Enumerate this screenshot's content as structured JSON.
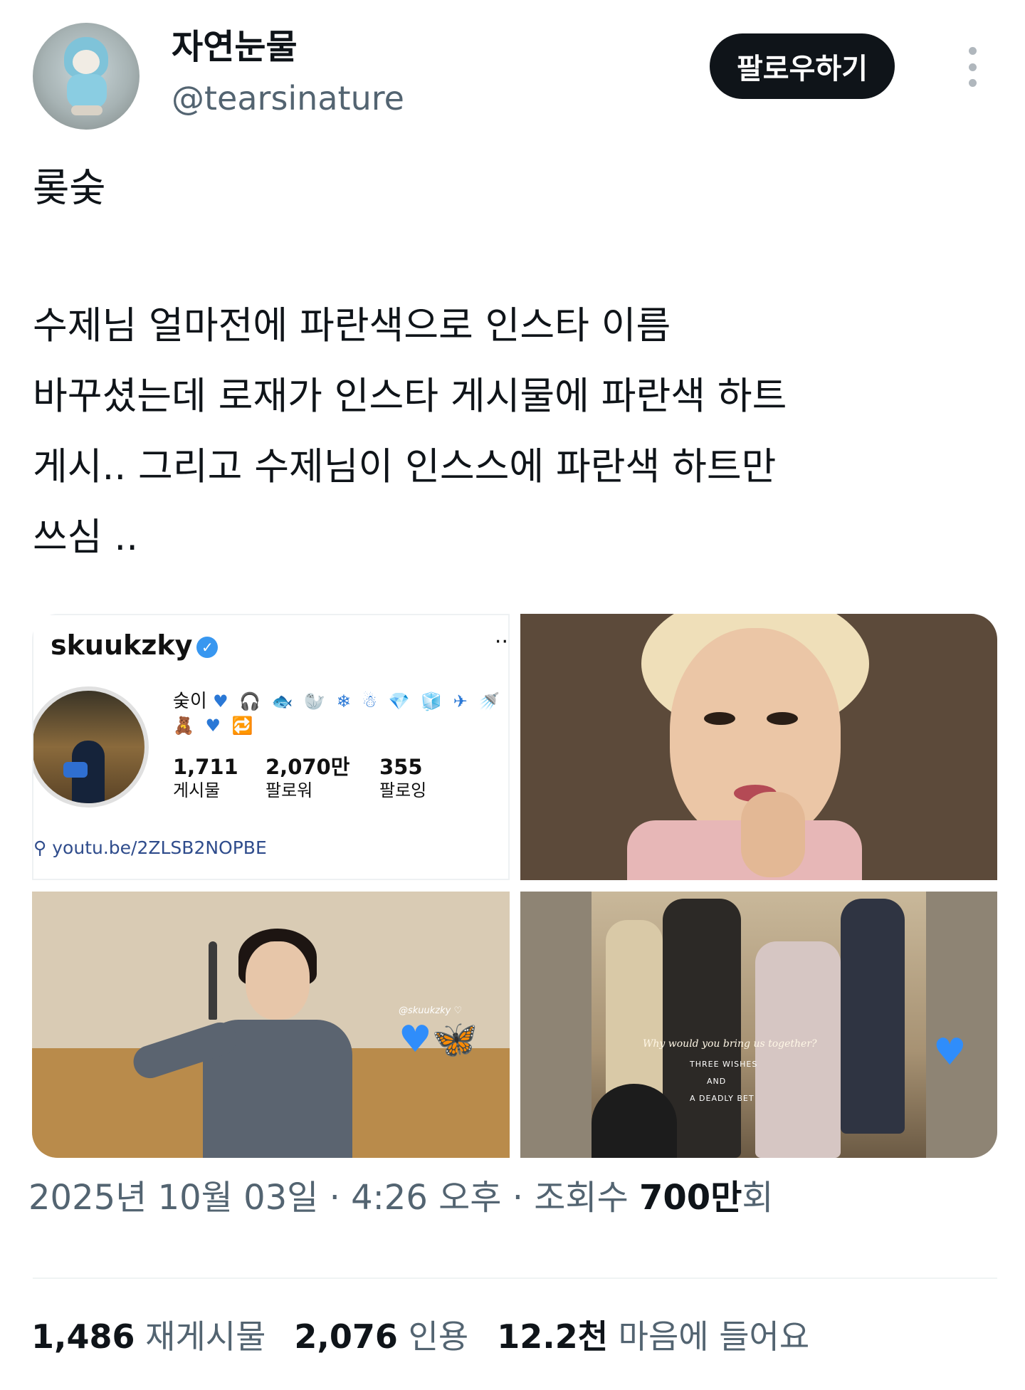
{
  "author": {
    "display_name": "자연눈물",
    "handle": "@tearsinature",
    "follow_label": "팔로우하기"
  },
  "tweet": {
    "title": "롲숮",
    "lines": [
      "수제님 얼마전에 파란색으로 인스타 이름",
      "바꾸셨는데 로재가 인스타 게시물에 파란색 하트",
      "게시.. 그리고 수제님이 인스스에 파란색 하트만",
      "쓰심 .."
    ]
  },
  "instagram_card": {
    "username": "skuukzky",
    "bio_name": "숮이",
    "bio_emojis_line1": "♥ 🎧 🐟 🦭 ❄ ☃ 💎 🧊 ✈ 🚿",
    "bio_emojis_line2": "🧸 ♥ 🔁",
    "stats": [
      {
        "value": "1,711",
        "label": "게시물"
      },
      {
        "value": "2,070만",
        "label": "팔로워"
      },
      {
        "value": "355",
        "label": "팔로잉"
      }
    ],
    "link": "youtu.be/2ZLSB2NOPBE"
  },
  "media": {
    "story_tag": "@skuukzky ♡",
    "story_hearts": "♥🦋",
    "poster_tagline": "Why would you bring us together?",
    "poster_line1": "THREE WISHES",
    "poster_line2": "AND",
    "poster_line3": "A DEADLY BET",
    "poster_heart": "♥"
  },
  "meta": {
    "date": "2025년 10월 03일",
    "sep1": " · ",
    "time": "4:26 오후",
    "sep2": " · ",
    "views_label": "조회수 ",
    "views_value": "700만",
    "views_suffix": "회"
  },
  "stats": {
    "reposts_value": "1,486",
    "reposts_label": "재게시물",
    "quotes_value": "2,076",
    "quotes_label": "인용",
    "likes_value": "12.2천",
    "likes_label": "마음에 들어요"
  },
  "colors": {
    "text": "#0f1419",
    "muted": "#536471",
    "divider": "#eff3f4",
    "button": "#0f1419",
    "heart_blue": "#2f8dfb"
  }
}
